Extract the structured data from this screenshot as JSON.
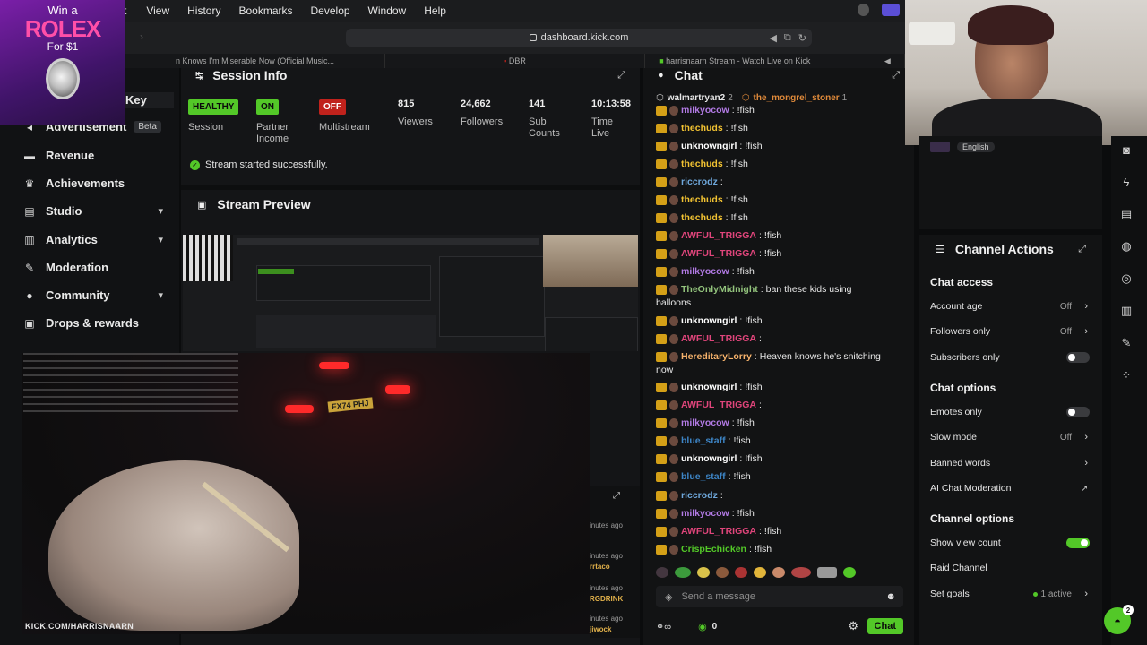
{
  "ad": {
    "line1": "Win a",
    "brand": "ROLEX",
    "line2": "For $1"
  },
  "menubar": {
    "frag": "t",
    "items": [
      "View",
      "History",
      "Bookmarks",
      "Develop",
      "Window",
      "Help"
    ]
  },
  "browser": {
    "url": "dashboard.kick.com",
    "tabs": [
      "n Knows I'm Miserable Now (Official Music...",
      "DBR",
      "harrisnaarn Stream - Watch Live on Kick"
    ]
  },
  "sidebar": {
    "partial_item": "Key",
    "items": [
      {
        "label": "Advertisement",
        "icon": "megaphone-icon",
        "badge": "Beta"
      },
      {
        "label": "Revenue",
        "icon": "money-icon"
      },
      {
        "label": "Achievements",
        "icon": "trophy-icon"
      },
      {
        "label": "Studio",
        "icon": "studio-icon",
        "expandable": true
      },
      {
        "label": "Analytics",
        "icon": "chart-icon",
        "expandable": true
      },
      {
        "label": "Moderation",
        "icon": "wrench-icon"
      },
      {
        "label": "Community",
        "icon": "people-icon",
        "expandable": true
      },
      {
        "label": "Drops & rewards",
        "icon": "gift-icon"
      }
    ]
  },
  "session": {
    "title": "Session Info",
    "stats": [
      {
        "badge": "HEALTHY",
        "label1": "Session",
        "label2": "",
        "color": "#53c828"
      },
      {
        "badge": "ON",
        "label1": "Partner",
        "label2": "Income",
        "color": "#53c828"
      },
      {
        "badge": "OFF",
        "label1": "Multistream",
        "label2": "",
        "color": "#c0221c"
      },
      {
        "value": "815",
        "label1": "Viewers",
        "label2": ""
      },
      {
        "value": "24,662",
        "label1": "Followers",
        "label2": ""
      },
      {
        "value": "141",
        "label1": "Sub",
        "label2": "Counts"
      },
      {
        "value": "10:13:58",
        "label1": "Time",
        "label2": "Live"
      }
    ],
    "status": "Stream started successfully."
  },
  "preview": {
    "title": "Stream Preview"
  },
  "overlay": {
    "watermark": "KICK.COM/HARRISNAARN",
    "plate": "FX74 PHJ",
    "side_items": [
      "inutes ago",
      "inutes ago",
      "rrtaco",
      "inutes ago",
      "RGDRINK",
      "inutes ago",
      "jiwock"
    ]
  },
  "chat": {
    "title": "Chat",
    "pinned": [
      {
        "user": "walmartryan2",
        "count": "2"
      },
      {
        "user": "the_mongrel_stoner",
        "count": "1"
      }
    ],
    "messages": [
      {
        "user": "milkyocow",
        "text": "!fish",
        "color": "#b37be6"
      },
      {
        "user": "thechuds",
        "text": "!fish",
        "color": "#f1c232"
      },
      {
        "user": "unknowngirl",
        "text": "!fish",
        "color": "#ffffff"
      },
      {
        "user": "thechuds",
        "text": "!fish",
        "color": "#f1c232"
      },
      {
        "user": "riccrodz",
        "text": "",
        "color": "#6fa8dc"
      },
      {
        "user": "thechuds",
        "text": "!fish",
        "color": "#f1c232"
      },
      {
        "user": "thechuds",
        "text": "!fish",
        "color": "#f1c232"
      },
      {
        "user": "AWFUL_TRIGGA",
        "text": "!fish",
        "color": "#e0457b"
      },
      {
        "user": "AWFUL_TRIGGA",
        "text": "!fish",
        "color": "#e0457b"
      },
      {
        "user": "milkyocow",
        "text": "!fish",
        "color": "#b37be6"
      },
      {
        "user": "TheOnlyMidnight",
        "text": "ban these kids using",
        "color": "#93c47d"
      },
      {
        "user": "",
        "text": "balloons",
        "color": "#ffffff"
      },
      {
        "user": "unknowngirl",
        "text": "!fish",
        "color": "#ffffff"
      },
      {
        "user": "AWFUL_TRIGGA",
        "text": "",
        "color": "#e0457b"
      },
      {
        "user": "HereditaryLorry",
        "text": "Heaven knows he's snitching",
        "color": "#f6b26b"
      },
      {
        "user": "",
        "text": "now",
        "color": "#ffffff"
      },
      {
        "user": "unknowngirl",
        "text": "!fish",
        "color": "#ffffff"
      },
      {
        "user": "AWFUL_TRIGGA",
        "text": "",
        "color": "#e0457b"
      },
      {
        "user": "milkyocow",
        "text": "!fish",
        "color": "#b37be6"
      },
      {
        "user": "blue_staff",
        "text": "!fish",
        "color": "#3d85c6"
      },
      {
        "user": "unknowngirl",
        "text": "!fish",
        "color": "#ffffff"
      },
      {
        "user": "blue_staff",
        "text": "!fish",
        "color": "#3d85c6"
      },
      {
        "user": "riccrodz",
        "text": "",
        "color": "#6fa8dc"
      },
      {
        "user": "milkyocow",
        "text": "!fish",
        "color": "#b37be6"
      },
      {
        "user": "AWFUL_TRIGGA",
        "text": "!fish",
        "color": "#e0457b"
      },
      {
        "user": "CrispEchicken",
        "text": "!fish",
        "color": "#53c828"
      }
    ],
    "input_placeholder": "Send a message",
    "points": "0",
    "send_label": "Chat"
  },
  "webcam": {
    "language": "English"
  },
  "actions": {
    "title": "Channel Actions",
    "sections": [
      {
        "heading": "Chat access",
        "rows": [
          {
            "label": "Account age",
            "value": "Off",
            "kind": "arrow"
          },
          {
            "label": "Followers only",
            "value": "Off",
            "kind": "arrow"
          },
          {
            "label": "Subscribers only",
            "value": "",
            "kind": "toggle-off"
          }
        ]
      },
      {
        "heading": "Chat options",
        "rows": [
          {
            "label": "Emotes only",
            "value": "",
            "kind": "toggle-off"
          },
          {
            "label": "Slow mode",
            "value": "Off",
            "kind": "arrow"
          },
          {
            "label": "Banned words",
            "value": "",
            "kind": "arrow"
          },
          {
            "label": "AI Chat Moderation",
            "value": "",
            "kind": "external"
          }
        ]
      },
      {
        "heading": "Channel options",
        "rows": [
          {
            "label": "Show view count",
            "value": "",
            "kind": "toggle-on"
          },
          {
            "label": "Raid Channel",
            "value": "",
            "kind": "none"
          },
          {
            "label": "Set goals",
            "value": "1 active",
            "kind": "arrow"
          }
        ]
      }
    ]
  },
  "support": {
    "count": "2"
  },
  "colors": {
    "accent": "#53c828",
    "off": "#c0221c",
    "panel": "#121314"
  }
}
